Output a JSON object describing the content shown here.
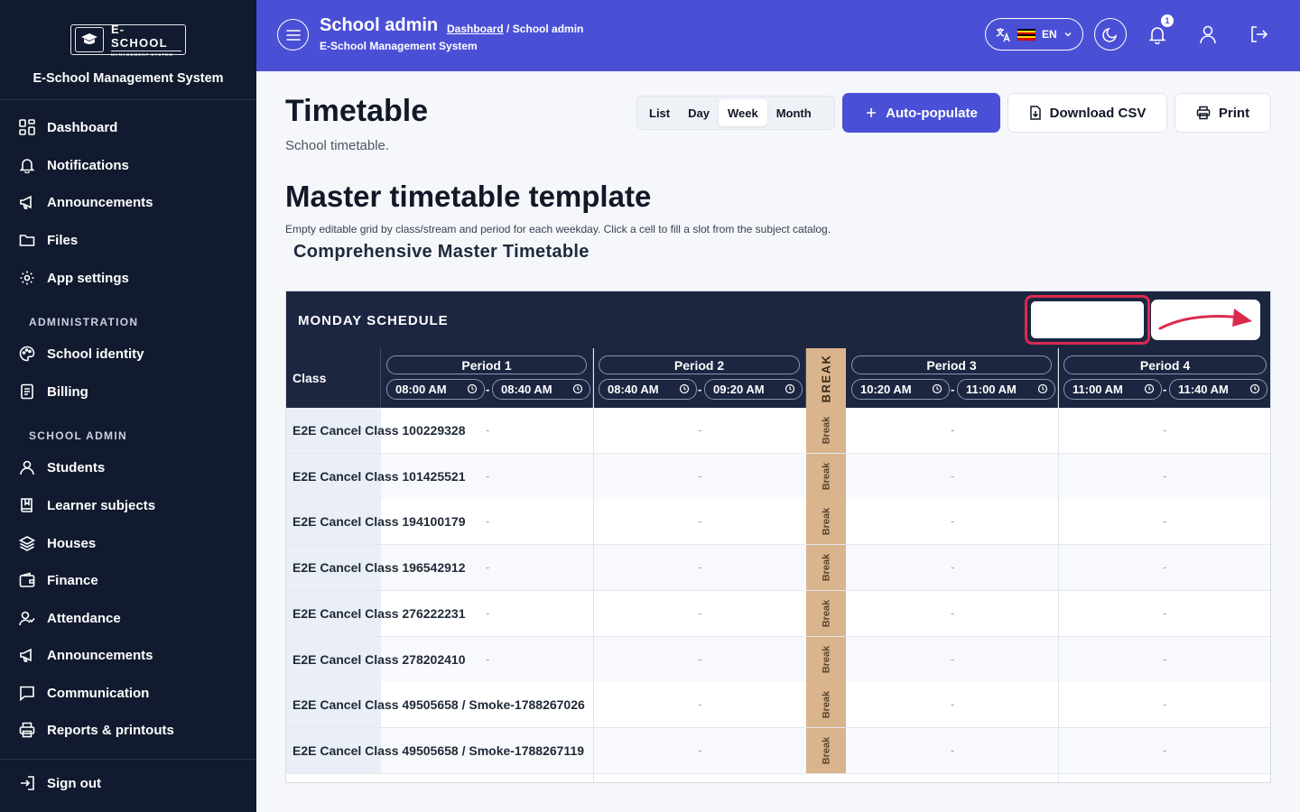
{
  "sidebar": {
    "logo_title": "E-SCHOOL",
    "logo_sub": "MANAGEMENT SYSTEM",
    "brand_name": "E-School Management System",
    "items": [
      {
        "label": "Dashboard",
        "icon": "dashboard-icon"
      },
      {
        "label": "Notifications",
        "icon": "bell-icon"
      },
      {
        "label": "Announcements",
        "icon": "megaphone-icon"
      },
      {
        "label": "Files",
        "icon": "folder-icon"
      },
      {
        "label": "App settings",
        "icon": "gear-icon"
      }
    ],
    "section_admin": "ADMINISTRATION",
    "admin_items": [
      {
        "label": "School identity",
        "icon": "palette-icon"
      },
      {
        "label": "Billing",
        "icon": "invoice-icon"
      }
    ],
    "section_school": "SCHOOL ADMIN",
    "school_items": [
      {
        "label": "Students",
        "icon": "user-icon"
      },
      {
        "label": "Learner subjects",
        "icon": "book-icon"
      },
      {
        "label": "Houses",
        "icon": "layers-icon"
      },
      {
        "label": "Finance",
        "icon": "wallet-icon"
      },
      {
        "label": "Attendance",
        "icon": "user-check-icon"
      },
      {
        "label": "Announcements",
        "icon": "megaphone-icon"
      },
      {
        "label": "Communication",
        "icon": "chat-icon"
      },
      {
        "label": "Reports & printouts",
        "icon": "printer-icon"
      }
    ],
    "signout": "Sign out"
  },
  "topbar": {
    "title": "School admin",
    "crumb_link": "Dashboard",
    "crumb_current": " / School admin",
    "subtitle": "E-School Management System",
    "lang": "EN",
    "notif_count": "1",
    "bg_color": "#4a50d6"
  },
  "main": {
    "title": "Timetable",
    "subtitle": "School timetable.",
    "view_tabs": [
      "List",
      "Day",
      "Week",
      "Month"
    ],
    "active_tab": "Week",
    "auto_populate": "Auto-populate",
    "download_csv": "Download CSV",
    "print": "Print",
    "section_title": "Master timetable template",
    "section_desc": "Empty editable grid by class/stream and period for each weekday. Click a cell to fill a slot from the subject catalog.",
    "tt_title": "Comprehensive Master Timetable"
  },
  "timetable": {
    "day": "MONDAY SCHEDULE",
    "class_header": "Class",
    "break_header": "BREAK",
    "break_cell": "Break",
    "empty_cell": "-",
    "periods": [
      {
        "name": "Period 1",
        "start": "08:00 AM",
        "end": "08:40 AM"
      },
      {
        "name": "Period 2",
        "start": "08:40 AM",
        "end": "09:20 AM"
      },
      {
        "name": "Period 3",
        "start": "10:20 AM",
        "end": "11:00 AM"
      },
      {
        "name": "Period 4",
        "start": "11:00 AM",
        "end": "11:40 AM"
      }
    ],
    "rows": [
      "E2E Cancel Class 100229328",
      "E2E Cancel Class 101425521",
      "E2E Cancel Class 194100179",
      "E2E Cancel Class 196542912",
      "E2E Cancel Class 276222231",
      "E2E Cancel Class 278202410",
      "E2E Cancel Class 49505658 / Smoke-1788267026",
      "E2E Cancel Class 49505658 / Smoke-1788267119"
    ]
  }
}
